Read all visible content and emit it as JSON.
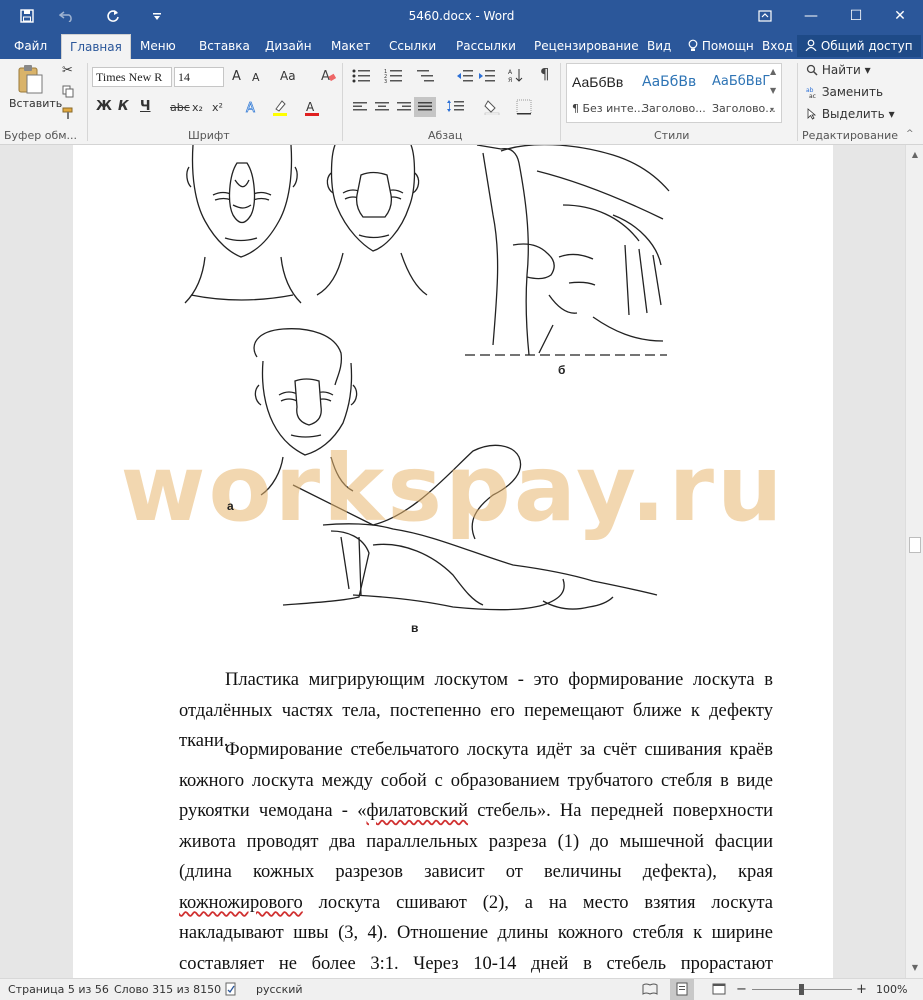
{
  "window": {
    "title": "5460.docx - Word",
    "qa_icons": [
      "save-icon",
      "undo-icon",
      "redo-icon",
      "customize-icon"
    ],
    "ribbon_display_icon": "ribbon-display-icon",
    "minimize": "—",
    "maximize": "☐",
    "close": "✕"
  },
  "tabs": [
    "Файл",
    "Главная",
    "Меню",
    "Вставка",
    "Дизайн",
    "Макет",
    "Ссылки",
    "Рассылки",
    "Рецензирование",
    "Вид"
  ],
  "active_tab": "Главная",
  "help": "Помощн",
  "signin": "Вход",
  "share": "Общий доступ",
  "ribbon": {
    "clipboard": {
      "paste": "Вставить",
      "label": "Буфер обм..."
    },
    "font": {
      "font_name": "Times New R",
      "font_size": "14",
      "grow": "A",
      "shrink": "A",
      "case": "Aa",
      "bold": "Ж",
      "italic": "К",
      "underline": "Ч",
      "strike": "abc",
      "subscript": "x₂",
      "superscript": "x²",
      "label": "Шрифт"
    },
    "paragraph": {
      "label": "Абзац",
      "pilcrow": "¶"
    },
    "styles": {
      "items": [
        {
          "sample": "АаБбВв",
          "name": "¶ Без инте..."
        },
        {
          "sample": "АаБбВв",
          "name": "Заголово..."
        },
        {
          "sample": "АаБбВвГ",
          "name": "Заголово..."
        }
      ],
      "label": "Стили"
    },
    "editing": {
      "find": "Найти",
      "replace": "Заменить",
      "select": "Выделить",
      "label": "Редактирование"
    }
  },
  "document": {
    "watermark": "workspay.ru",
    "figure_labels": {
      "a": "а",
      "b": "б",
      "v": "в"
    },
    "para1": "Пластика мигрирующим лоскутом - это формирование лоскута в отдалённых частях тела, постепенно его перемещают ближе к дефекту ткани.",
    "para2": {
      "part1": "Формирование стебельчатого лоскута идёт за счёт сшивания краёв кожного лоскута между собой с образованием трубчатого стебля в виде рукоятки чемодана - «",
      "word1": "филатовский",
      "part2": " стебель». На передней поверхности живота проводят два параллельных разреза (1) до мышечной фасции (длина кожных разрезов зависит от величины дефекта), края ",
      "word2": "кожножирового",
      "part3": " лоскута сшивают (2), а на место взятия лоскута накладывают швы (3, 4). Отношение длины кожного стебля к ширине составляет не более 3:1. Через 10-14 дней в стебель прорастают кровеносные сосуды,"
    }
  },
  "status": {
    "page": "Страница 5 из 56",
    "words": "Слово 315 из 8150",
    "language": "русский",
    "zoom": "100%"
  },
  "colors": {
    "word_blue": "#2b579a",
    "watermark": "#e8b670"
  }
}
